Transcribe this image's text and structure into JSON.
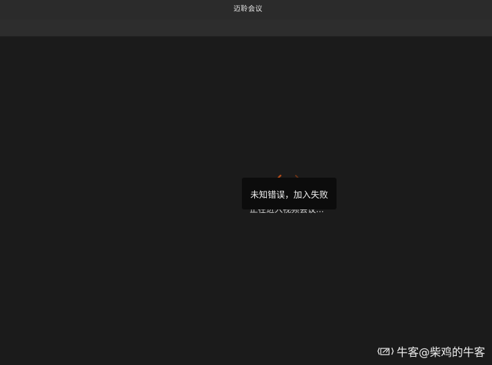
{
  "window": {
    "title": "迈聆会议"
  },
  "meeting": {
    "status_text": "正在进入视频会议..."
  },
  "toast": {
    "message": "未知错误，加入失败"
  },
  "watermark": {
    "text": "牛客@柴鸡的牛客",
    "icon": "newcoder-logo-icon"
  },
  "colors": {
    "titlebar": "#2b2b2b",
    "background": "#1b1b1b",
    "toast_background": "#0c0c0c",
    "spinner_accent": "#c0501a"
  }
}
